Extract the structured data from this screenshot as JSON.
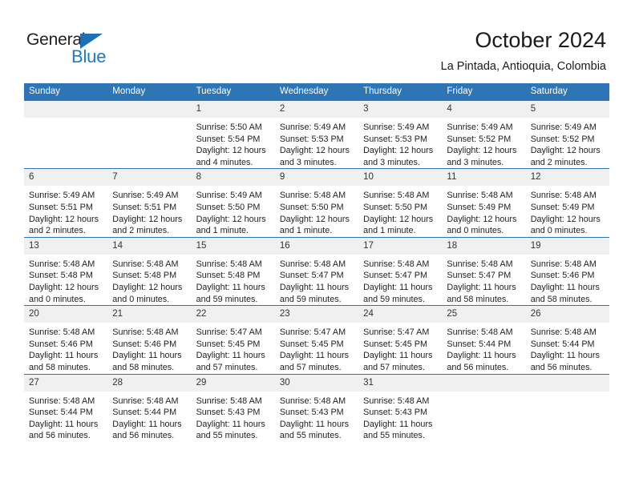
{
  "brand": {
    "name_part1": "General",
    "name_part2": "Blue",
    "triangle_color": "#1f6fb5",
    "blue_color": "#1f7ac0"
  },
  "header": {
    "title": "October 2024",
    "subtitle": "La Pintada, Antioquia, Colombia"
  },
  "theme": {
    "header_blue": "#2e75b6",
    "daynum_band": "#f0f0f0"
  },
  "weekday_headers": [
    "Sunday",
    "Monday",
    "Tuesday",
    "Wednesday",
    "Thursday",
    "Friday",
    "Saturday"
  ],
  "weeks": [
    [
      {
        "day": "",
        "sunrise": "",
        "sunset": "",
        "daylight_line1": "",
        "daylight_line2": ""
      },
      {
        "day": "",
        "sunrise": "",
        "sunset": "",
        "daylight_line1": "",
        "daylight_line2": ""
      },
      {
        "day": "1",
        "sunrise": "Sunrise: 5:50 AM",
        "sunset": "Sunset: 5:54 PM",
        "daylight_line1": "Daylight: 12 hours",
        "daylight_line2": "and 4 minutes."
      },
      {
        "day": "2",
        "sunrise": "Sunrise: 5:49 AM",
        "sunset": "Sunset: 5:53 PM",
        "daylight_line1": "Daylight: 12 hours",
        "daylight_line2": "and 3 minutes."
      },
      {
        "day": "3",
        "sunrise": "Sunrise: 5:49 AM",
        "sunset": "Sunset: 5:53 PM",
        "daylight_line1": "Daylight: 12 hours",
        "daylight_line2": "and 3 minutes."
      },
      {
        "day": "4",
        "sunrise": "Sunrise: 5:49 AM",
        "sunset": "Sunset: 5:52 PM",
        "daylight_line1": "Daylight: 12 hours",
        "daylight_line2": "and 3 minutes."
      },
      {
        "day": "5",
        "sunrise": "Sunrise: 5:49 AM",
        "sunset": "Sunset: 5:52 PM",
        "daylight_line1": "Daylight: 12 hours",
        "daylight_line2": "and 2 minutes."
      }
    ],
    [
      {
        "day": "6",
        "sunrise": "Sunrise: 5:49 AM",
        "sunset": "Sunset: 5:51 PM",
        "daylight_line1": "Daylight: 12 hours",
        "daylight_line2": "and 2 minutes."
      },
      {
        "day": "7",
        "sunrise": "Sunrise: 5:49 AM",
        "sunset": "Sunset: 5:51 PM",
        "daylight_line1": "Daylight: 12 hours",
        "daylight_line2": "and 2 minutes."
      },
      {
        "day": "8",
        "sunrise": "Sunrise: 5:49 AM",
        "sunset": "Sunset: 5:50 PM",
        "daylight_line1": "Daylight: 12 hours",
        "daylight_line2": "and 1 minute."
      },
      {
        "day": "9",
        "sunrise": "Sunrise: 5:48 AM",
        "sunset": "Sunset: 5:50 PM",
        "daylight_line1": "Daylight: 12 hours",
        "daylight_line2": "and 1 minute."
      },
      {
        "day": "10",
        "sunrise": "Sunrise: 5:48 AM",
        "sunset": "Sunset: 5:50 PM",
        "daylight_line1": "Daylight: 12 hours",
        "daylight_line2": "and 1 minute."
      },
      {
        "day": "11",
        "sunrise": "Sunrise: 5:48 AM",
        "sunset": "Sunset: 5:49 PM",
        "daylight_line1": "Daylight: 12 hours",
        "daylight_line2": "and 0 minutes."
      },
      {
        "day": "12",
        "sunrise": "Sunrise: 5:48 AM",
        "sunset": "Sunset: 5:49 PM",
        "daylight_line1": "Daylight: 12 hours",
        "daylight_line2": "and 0 minutes."
      }
    ],
    [
      {
        "day": "13",
        "sunrise": "Sunrise: 5:48 AM",
        "sunset": "Sunset: 5:48 PM",
        "daylight_line1": "Daylight: 12 hours",
        "daylight_line2": "and 0 minutes."
      },
      {
        "day": "14",
        "sunrise": "Sunrise: 5:48 AM",
        "sunset": "Sunset: 5:48 PM",
        "daylight_line1": "Daylight: 12 hours",
        "daylight_line2": "and 0 minutes."
      },
      {
        "day": "15",
        "sunrise": "Sunrise: 5:48 AM",
        "sunset": "Sunset: 5:48 PM",
        "daylight_line1": "Daylight: 11 hours",
        "daylight_line2": "and 59 minutes."
      },
      {
        "day": "16",
        "sunrise": "Sunrise: 5:48 AM",
        "sunset": "Sunset: 5:47 PM",
        "daylight_line1": "Daylight: 11 hours",
        "daylight_line2": "and 59 minutes."
      },
      {
        "day": "17",
        "sunrise": "Sunrise: 5:48 AM",
        "sunset": "Sunset: 5:47 PM",
        "daylight_line1": "Daylight: 11 hours",
        "daylight_line2": "and 59 minutes."
      },
      {
        "day": "18",
        "sunrise": "Sunrise: 5:48 AM",
        "sunset": "Sunset: 5:47 PM",
        "daylight_line1": "Daylight: 11 hours",
        "daylight_line2": "and 58 minutes."
      },
      {
        "day": "19",
        "sunrise": "Sunrise: 5:48 AM",
        "sunset": "Sunset: 5:46 PM",
        "daylight_line1": "Daylight: 11 hours",
        "daylight_line2": "and 58 minutes."
      }
    ],
    [
      {
        "day": "20",
        "sunrise": "Sunrise: 5:48 AM",
        "sunset": "Sunset: 5:46 PM",
        "daylight_line1": "Daylight: 11 hours",
        "daylight_line2": "and 58 minutes."
      },
      {
        "day": "21",
        "sunrise": "Sunrise: 5:48 AM",
        "sunset": "Sunset: 5:46 PM",
        "daylight_line1": "Daylight: 11 hours",
        "daylight_line2": "and 58 minutes."
      },
      {
        "day": "22",
        "sunrise": "Sunrise: 5:47 AM",
        "sunset": "Sunset: 5:45 PM",
        "daylight_line1": "Daylight: 11 hours",
        "daylight_line2": "and 57 minutes."
      },
      {
        "day": "23",
        "sunrise": "Sunrise: 5:47 AM",
        "sunset": "Sunset: 5:45 PM",
        "daylight_line1": "Daylight: 11 hours",
        "daylight_line2": "and 57 minutes."
      },
      {
        "day": "24",
        "sunrise": "Sunrise: 5:47 AM",
        "sunset": "Sunset: 5:45 PM",
        "daylight_line1": "Daylight: 11 hours",
        "daylight_line2": "and 57 minutes."
      },
      {
        "day": "25",
        "sunrise": "Sunrise: 5:48 AM",
        "sunset": "Sunset: 5:44 PM",
        "daylight_line1": "Daylight: 11 hours",
        "daylight_line2": "and 56 minutes."
      },
      {
        "day": "26",
        "sunrise": "Sunrise: 5:48 AM",
        "sunset": "Sunset: 5:44 PM",
        "daylight_line1": "Daylight: 11 hours",
        "daylight_line2": "and 56 minutes."
      }
    ],
    [
      {
        "day": "27",
        "sunrise": "Sunrise: 5:48 AM",
        "sunset": "Sunset: 5:44 PM",
        "daylight_line1": "Daylight: 11 hours",
        "daylight_line2": "and 56 minutes."
      },
      {
        "day": "28",
        "sunrise": "Sunrise: 5:48 AM",
        "sunset": "Sunset: 5:44 PM",
        "daylight_line1": "Daylight: 11 hours",
        "daylight_line2": "and 56 minutes."
      },
      {
        "day": "29",
        "sunrise": "Sunrise: 5:48 AM",
        "sunset": "Sunset: 5:43 PM",
        "daylight_line1": "Daylight: 11 hours",
        "daylight_line2": "and 55 minutes."
      },
      {
        "day": "30",
        "sunrise": "Sunrise: 5:48 AM",
        "sunset": "Sunset: 5:43 PM",
        "daylight_line1": "Daylight: 11 hours",
        "daylight_line2": "and 55 minutes."
      },
      {
        "day": "31",
        "sunrise": "Sunrise: 5:48 AM",
        "sunset": "Sunset: 5:43 PM",
        "daylight_line1": "Daylight: 11 hours",
        "daylight_line2": "and 55 minutes."
      },
      {
        "day": "",
        "sunrise": "",
        "sunset": "",
        "daylight_line1": "",
        "daylight_line2": ""
      },
      {
        "day": "",
        "sunrise": "",
        "sunset": "",
        "daylight_line1": "",
        "daylight_line2": ""
      }
    ]
  ]
}
